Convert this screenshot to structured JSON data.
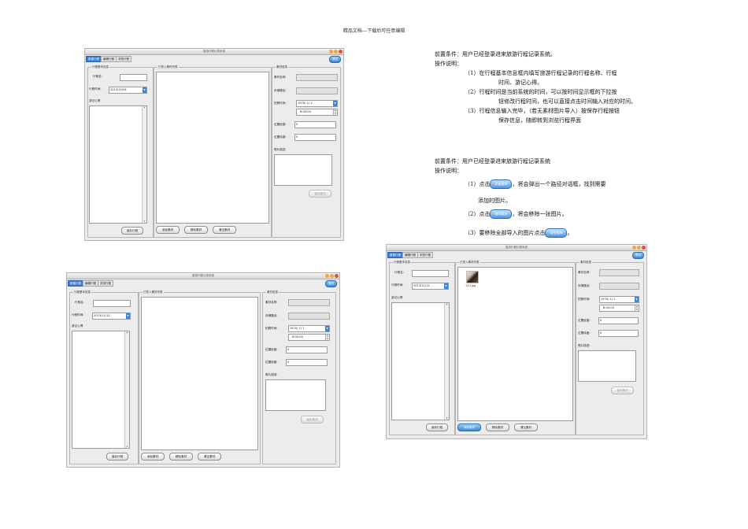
{
  "doc_header": "精品文档---下载后可任意编辑",
  "app": {
    "title": "旅游行程记录系统",
    "tabs": [
      "新建行程",
      "编辑行程",
      "浏览行程"
    ],
    "exit_label": "退出",
    "basic_group": "行程基本信息",
    "name_label": "行程名:",
    "time_label": "行程时间:",
    "notes_label": "游记心得",
    "save_trip": "保存行程",
    "imported_group": "已导入素材列表",
    "add_material": "添加素材",
    "remove_material": "移除素材",
    "clear_material": "清空素材",
    "material_group": "素材信息",
    "mat_name_label": "素材名称:",
    "mat_path_label": "存储路径:",
    "shot_time_label": "拍照时间:",
    "shot_date": "1970/ 1/ 1",
    "shot_clock": "8:00:00",
    "lon_label": "位置经度:",
    "lat_label": "位置纬度:",
    "lon_value": "0",
    "lat_value": "0",
    "photo_desc_label": "照片描述:",
    "save_material": "保存素材"
  },
  "screens": [
    {
      "date": "2013/10/24"
    },
    {
      "date": "2013/11/12"
    },
    {
      "date": "2013/11/12",
      "file": "123.jpg"
    }
  ],
  "section1": {
    "precondition": "前置条件：用户已经登录进来旅游行程记录系统。",
    "ops": "操作说明：",
    "l1a": "（1）在行程基本信息框内填写旅游行程记录的行程名称、行程",
    "l1b": "时间、游记心得。",
    "l2a": "（2）行程时间是当前系统的时间，可以按时间显示框的下拉按",
    "l2b": "钮修改行程时间，也可以直接点击时间输入对应的时间。",
    "l3a": "（3）行程信息输入完毕，（若无素材图片导入）按保存行程按钮",
    "l3b": "保存信息，随即转到浏览行程界面"
  },
  "section2": {
    "precondition": "前置条件：用户已经登录进来旅游行程记录系统",
    "ops": "操作说明：",
    "s1_pre": "（1）点击",
    "s1_post": "，将会弹出一个路径对话框，找到需要",
    "s1_cont": "添加的图片。",
    "s2_pre": "（2）点击",
    "s2_post": "，将会移除一张图片。",
    "s3_pre": "（3）要移除全部导入的图片点击",
    "s3_post": "。",
    "btn_add": "添加素材",
    "btn_remove": "移除素材",
    "btn_clear": "清空素材"
  }
}
